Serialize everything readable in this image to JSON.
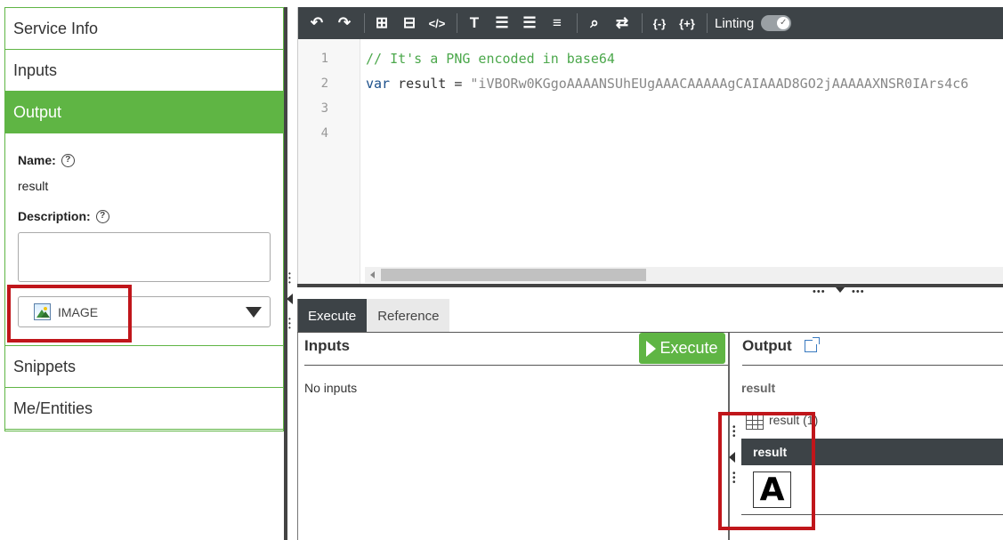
{
  "sidebar": {
    "service_info": "Service Info",
    "inputs": "Inputs",
    "output": "Output",
    "name_label": "Name:",
    "name_value": "result",
    "description_label": "Description:",
    "type_value": "IMAGE",
    "snippets": "Snippets",
    "me_entities": "Me/Entities"
  },
  "toolbar": {
    "icons": [
      "undo-icon",
      "redo-icon",
      "add-comment-icon",
      "remove-comment-icon",
      "code-icon",
      "text-size-icon",
      "indent-left-icon",
      "indent-right-icon",
      "align-justify-icon",
      "search-icon",
      "replace-icon",
      "braces-icon",
      "braces-plus-icon"
    ],
    "glyphs": [
      "↶",
      "↷",
      "⊞",
      "⊟",
      "</>",
      "T",
      "☰",
      "☰",
      "≡",
      "🔍",
      "⇄",
      "{-}",
      "{+}"
    ],
    "linting_label": "Linting"
  },
  "editor": {
    "line_numbers": [
      "1",
      "2",
      "3",
      "4"
    ],
    "line1_comment": "// It's a PNG encoded in base64",
    "line2_kw": "var",
    "line2_var": " result = ",
    "line2_str": "\"iVBORw0KGgoAAAANSUhEUgAAACAAAAAgCAIAAAD8GO2jAAAAAXNSR0IArs4c6"
  },
  "tabs": {
    "execute": "Execute",
    "reference": "Reference"
  },
  "inputs_panel": {
    "title": "Inputs",
    "execute_button": "Execute",
    "no_inputs": "No inputs"
  },
  "output_panel": {
    "title": "Output",
    "result_label": "result",
    "result_count": "result (1)",
    "result_header": "result",
    "result_image_letter": "A"
  },
  "colors": {
    "accent_green": "#5fb544",
    "toolbar_dark": "#3d4347",
    "highlight_red": "#c0161b"
  }
}
